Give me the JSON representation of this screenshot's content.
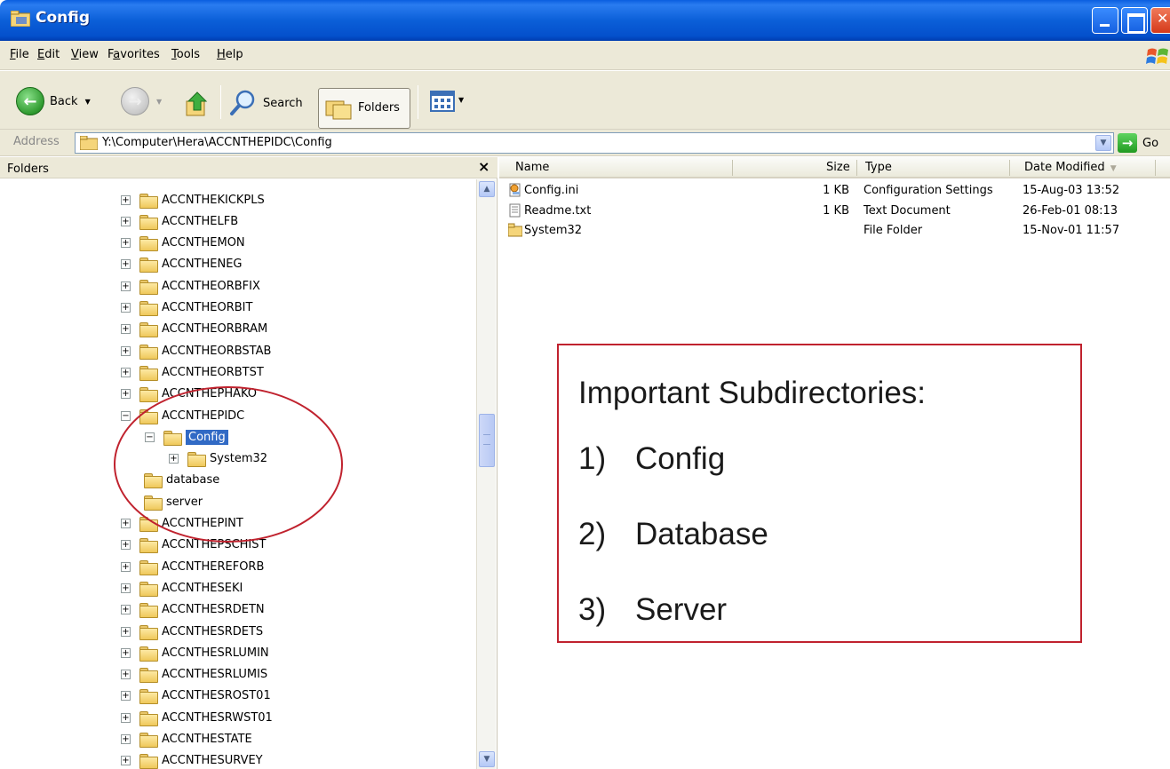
{
  "window": {
    "title": "Config"
  },
  "menu": [
    {
      "label": "File",
      "u": "F",
      "rest": "ile"
    },
    {
      "label": "Edit",
      "u": "E",
      "rest": "dit"
    },
    {
      "label": "View",
      "u": "V",
      "rest": "iew"
    },
    {
      "label": "Favorites",
      "u": "a",
      "pre": "F",
      "rest": "vorites"
    },
    {
      "label": "Tools",
      "u": "T",
      "rest": "ools"
    },
    {
      "label": "Help",
      "u": "H",
      "rest": "elp"
    }
  ],
  "toolbar": {
    "back_label": "Back",
    "search_label": "Search",
    "folders_label": "Folders"
  },
  "address": {
    "label": "Address",
    "path": "Y:\\Computer\\Hera\\ACCNTHEPIDC\\Config",
    "go_label": "Go"
  },
  "folders_pane": {
    "title": "Folders",
    "close_symbol": "×",
    "items": [
      {
        "label": "ACCNTHEKICKPLS",
        "expander": "+"
      },
      {
        "label": "ACCNTHELFB",
        "expander": "+"
      },
      {
        "label": "ACCNTHEMON",
        "expander": "+"
      },
      {
        "label": "ACCNTHENEG",
        "expander": "+"
      },
      {
        "label": "ACCNTHEORBFIX",
        "expander": "+"
      },
      {
        "label": "ACCNTHEORBIT",
        "expander": "+"
      },
      {
        "label": "ACCNTHEORBRAM",
        "expander": "+"
      },
      {
        "label": "ACCNTHEORBSTAB",
        "expander": "+"
      },
      {
        "label": "ACCNTHEORBTST",
        "expander": "+"
      },
      {
        "label": "ACCNTHEPHAKO",
        "expander": "+"
      },
      {
        "label": "ACCNTHEPIDC",
        "expander": "−"
      },
      {
        "label": "Config",
        "expander": "−",
        "selected": true
      },
      {
        "label": "System32",
        "expander": "+"
      },
      {
        "label": "database",
        "expander": ""
      },
      {
        "label": "server",
        "expander": ""
      },
      {
        "label": "ACCNTHEPINT",
        "expander": "+"
      },
      {
        "label": "ACCNTHEPSCHIST",
        "expander": "+"
      },
      {
        "label": "ACCNTHEREFORB",
        "expander": "+"
      },
      {
        "label": "ACCNTHESEKI",
        "expander": "+"
      },
      {
        "label": "ACCNTHESRDETN",
        "expander": "+"
      },
      {
        "label": "ACCNTHESRDETS",
        "expander": "+"
      },
      {
        "label": "ACCNTHESRLUMIN",
        "expander": "+"
      },
      {
        "label": "ACCNTHESRLUMIS",
        "expander": "+"
      },
      {
        "label": "ACCNTHESROST01",
        "expander": "+"
      },
      {
        "label": "ACCNTHESRWST01",
        "expander": "+"
      },
      {
        "label": "ACCNTHESTATE",
        "expander": "+"
      },
      {
        "label": "ACCNTHESURVEY",
        "expander": "+"
      }
    ]
  },
  "file_list": {
    "columns": {
      "name": "Name",
      "size": "Size",
      "type": "Type",
      "date": "Date Modified"
    },
    "rows": [
      {
        "name": "Config.ini",
        "size": "1 KB",
        "type": "Configuration Settings",
        "date": "15-Aug-03 13:52",
        "icon": "config-file-icon"
      },
      {
        "name": "Readme.txt",
        "size": "1 KB",
        "type": "Text Document",
        "date": "26-Feb-01 08:13",
        "icon": "text-file-icon"
      },
      {
        "name": "System32",
        "size": "",
        "type": "File Folder",
        "date": "15-Nov-01 11:57",
        "icon": "folder-icon"
      }
    ]
  },
  "annotation": {
    "title": "Important Subdirectories:",
    "items": [
      {
        "num": "1)",
        "text": "Config"
      },
      {
        "num": "2)",
        "text": "Database"
      },
      {
        "num": "3)",
        "text": "Server"
      }
    ]
  },
  "colors": {
    "title_bar": "#0b5fd8",
    "selection": "#316ac5",
    "annotation_red": "#c0222e"
  }
}
